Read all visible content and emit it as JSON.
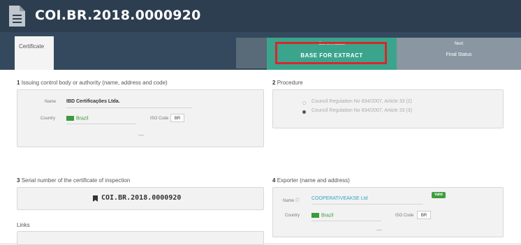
{
  "header": {
    "doc_id": "COI.BR.2018.0000920"
  },
  "tabs": {
    "certificate": "Certificate"
  },
  "status": {
    "current_label": "Current status",
    "current_value": "BASE FOR EXTRACT",
    "next_label": "Next",
    "next_value": "Final Status"
  },
  "section1": {
    "number": "1",
    "title": "Issuing control body or authority (name, address and code)",
    "name_label": "Name",
    "name_value": "IBD Certificações Ltda.",
    "country_label": "Country",
    "country_value": "Brazil",
    "iso_label": "ISO Code",
    "iso_value": "BR",
    "more": "---"
  },
  "section2": {
    "number": "2",
    "title": "Procedure",
    "options": [
      {
        "label": "Council Regulation No 834/2007, Article 33 (2)",
        "selected": false
      },
      {
        "label": "Council Regulation No 834/2007, Article 33 (3)",
        "selected": true
      }
    ]
  },
  "section3": {
    "number": "3",
    "title": "Serial number of the certificate of inspection",
    "serial": "COI.BR.2018.0000920"
  },
  "links": {
    "title": "Links"
  },
  "section4": {
    "number": "4",
    "title": "Exporter (name and address)",
    "name_label": "Name ⓘ",
    "name_value": "COOPERATIVEAKSE Ltd",
    "badge": "Valid",
    "country_label": "Country",
    "country_value": "Brazil",
    "iso_label": "ISO Code",
    "iso_value": "BR",
    "more": "---"
  },
  "colors": {
    "header_bg": "#2c3e50",
    "status_current": "#3aa58c",
    "status_next": "#8a97a2",
    "highlight": "#d9262c",
    "valid_badge": "#3e9d3e",
    "link": "#2ea3c8"
  },
  "icons": [
    "document-icon",
    "bookmark-icon",
    "brazil-flag-icon"
  ]
}
